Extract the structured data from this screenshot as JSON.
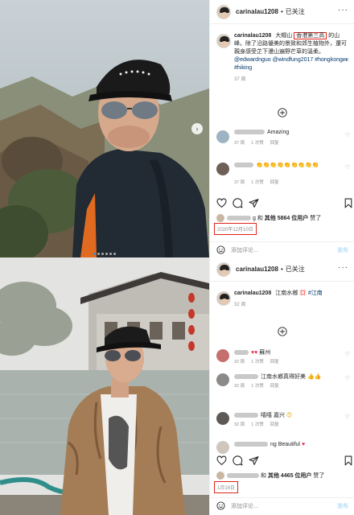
{
  "post1": {
    "username": "carinalau1208",
    "follow_label": "已关注",
    "caption": {
      "text_a": "大帽山",
      "highlight": "香港第三高",
      "text_b": "的山峰。除了沿路優美的景致和郊生植物外，還可親身感受芷下漫山遍野芒草的溫柔。",
      "mentions": "@edwardnguo @windfung2017",
      "tags": "#hongkongик #hiking",
      "time": "37 周"
    },
    "comments": [
      {
        "text": "Amazing",
        "meta": [
          "37 周",
          "1 次赞",
          "回复"
        ]
      },
      {
        "text": "👏👏👏👏👏👏👏👏👏",
        "meta": [
          "37 周",
          "1 次赞",
          "回复"
        ]
      }
    ],
    "likes": {
      "prefix": "g 和",
      "bold": "其他 5864 位用户",
      "suffix": "赞了"
    },
    "date": "2020年12月10日",
    "add_comment_placeholder": "添加评论...",
    "post_label": "发布"
  },
  "post2": {
    "username": "carinalau1208",
    "follow_label": "已关注",
    "caption": {
      "text": "江南水鄉",
      "emoji": "💢",
      "tags": "#江南",
      "time": "32 周"
    },
    "comments": [
      {
        "text": "蘇州",
        "meta": [
          "32 周",
          "1 次赞",
          "回复"
        ]
      },
      {
        "text": "江南水鄉真得好美",
        "meta": [
          "32 周",
          "1 次赞",
          "回复"
        ]
      },
      {
        "text": "嘻嘻 嘉兴",
        "meta": [
          "32 周",
          "1 次赞",
          "回复"
        ]
      },
      {
        "text": "ng Beautiful",
        "meta": []
      }
    ],
    "likes": {
      "prefix": "和",
      "bold": "其他 4465 位用户",
      "suffix": "赞了"
    },
    "date": "1月16日",
    "add_comment_placeholder": "添加评论...",
    "post_label": "发布"
  },
  "colors": {
    "highlight_box": "#e0241b",
    "link": "#00376b",
    "muted": "#8e8e8e",
    "border": "#efefef"
  }
}
